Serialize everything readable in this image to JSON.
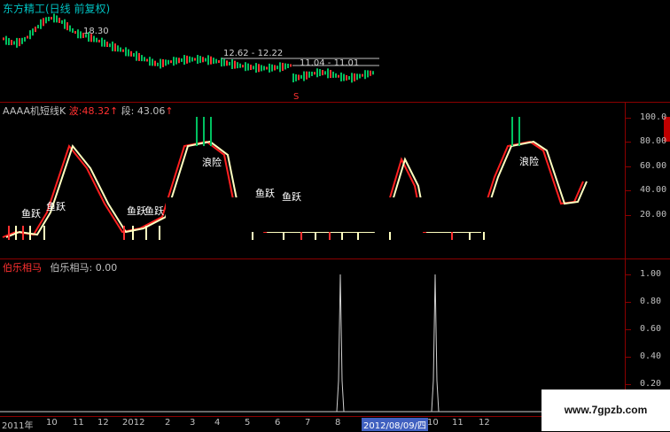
{
  "main_panel": {
    "title": "东方精工(日线 前复权)",
    "high_label": "18.30",
    "range_label_1": "12.62 - 12.22",
    "range_label_2": "11.04 - 11.01",
    "marker": "S"
  },
  "indicator_panel": {
    "name": "AAAA机短线K",
    "wave_label": "波:",
    "wave_value": "48.32",
    "segment_label": "段:",
    "segment_value": "43.06",
    "annotations": [
      "鱼跃",
      "鱼跃",
      "鱼跃",
      "鱼跃",
      "浪险",
      "鱼跃",
      "鱼跃",
      "浪险"
    ],
    "yaxis": [
      "100.0",
      "80.00",
      "60.00",
      "40.00",
      "20.00"
    ]
  },
  "bole_panel": {
    "name": "伯乐相马",
    "value_label": "伯乐相马: 0.00",
    "yaxis": [
      "1.00",
      "0.80",
      "0.60",
      "0.40",
      "0.20"
    ]
  },
  "time_axis": {
    "labels": [
      "2011年",
      "10",
      "11",
      "12",
      "2012",
      "2",
      "3",
      "4",
      "5",
      "6",
      "7",
      "8",
      "2012/08/09/四",
      "10",
      "11",
      "12"
    ]
  },
  "watermark": "www.7gpzb.com",
  "colors": {
    "red_line": "#ff2020",
    "yellow_line": "#ffffc0",
    "green_price": "#00c060",
    "red_price": "#ff3030",
    "grid": "#8b0000"
  }
}
